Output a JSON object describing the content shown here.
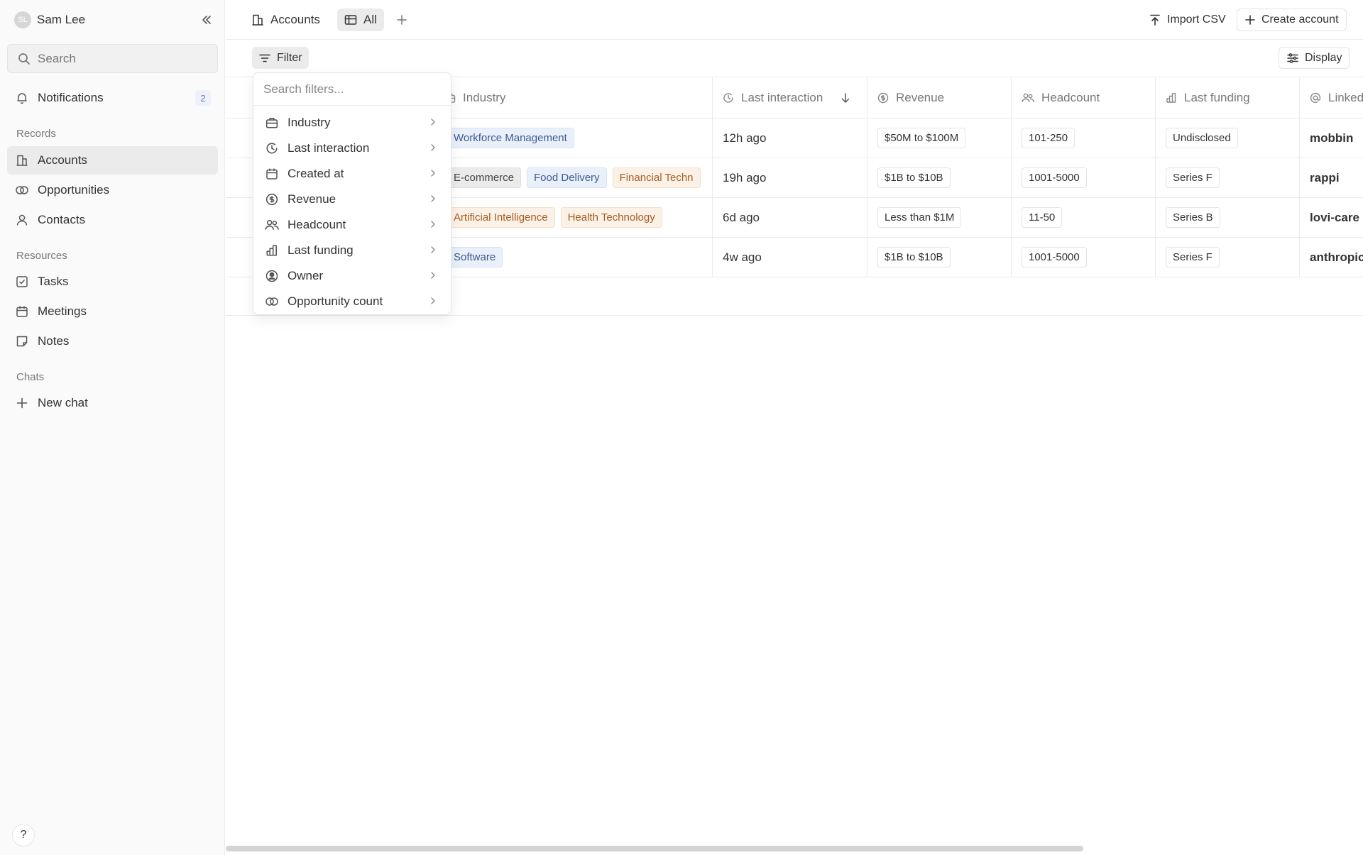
{
  "user": {
    "initials": "SL",
    "name": "Sam Lee"
  },
  "sidebar": {
    "search_placeholder": "Search",
    "notifications": {
      "label": "Notifications",
      "count": "2"
    },
    "sections": {
      "records": "Records",
      "resources": "Resources",
      "chats": "Chats"
    },
    "records": [
      {
        "label": "Accounts",
        "icon": "building-icon",
        "active": true
      },
      {
        "label": "Opportunities",
        "icon": "opportunities-icon",
        "active": false
      },
      {
        "label": "Contacts",
        "icon": "person-icon",
        "active": false
      }
    ],
    "resources": [
      {
        "label": "Tasks",
        "icon": "checkbox-icon"
      },
      {
        "label": "Meetings",
        "icon": "calendar-icon"
      },
      {
        "label": "Notes",
        "icon": "note-icon"
      }
    ],
    "new_chat": "New chat",
    "help": "?"
  },
  "topbar": {
    "object_label": "Accounts",
    "view_label": "All",
    "import_label": "Import CSV",
    "create_label": "Create account"
  },
  "toolbar": {
    "filter_label": "Filter",
    "display_label": "Display"
  },
  "table": {
    "headers": {
      "industry": "Industry",
      "last_interaction": "Last interaction",
      "revenue": "Revenue",
      "headcount": "Headcount",
      "last_funding": "Last funding",
      "linkedin": "Linked"
    },
    "rows": [
      {
        "industries": [
          {
            "label": "Workforce Management",
            "color": "blue"
          }
        ],
        "last_interaction": "12h ago",
        "revenue": "$50M to $100M",
        "headcount": "101-250",
        "last_funding": "Undisclosed",
        "linkedin": "mobbin"
      },
      {
        "industries": [
          {
            "label": "E-commerce",
            "color": "gray"
          },
          {
            "label": "Food Delivery",
            "color": "blue"
          },
          {
            "label": "Financial Techn",
            "color": "orange"
          }
        ],
        "last_interaction": "19h ago",
        "revenue": "$1B to $10B",
        "headcount": "1001-5000",
        "last_funding": "Series F",
        "linkedin": "rappi"
      },
      {
        "industries": [
          {
            "label": "Artificial Intelligence",
            "color": "orange"
          },
          {
            "label": "Health Technology",
            "color": "orange"
          }
        ],
        "last_interaction": "6d ago",
        "revenue": "Less than $1M",
        "headcount": "11-50",
        "last_funding": "Series B",
        "linkedin": "lovi-care"
      },
      {
        "industries": [
          {
            "label": "Software",
            "color": "blue"
          }
        ],
        "last_interaction": "4w ago",
        "revenue": "$1B to $10B",
        "headcount": "1001-5000",
        "last_funding": "Series F",
        "linkedin": "anthropic"
      }
    ]
  },
  "filter_menu": {
    "search_placeholder": "Search filters...",
    "items": [
      {
        "label": "Industry",
        "icon": "briefcase-icon"
      },
      {
        "label": "Last interaction",
        "icon": "interaction-icon"
      },
      {
        "label": "Created at",
        "icon": "calendar-icon"
      },
      {
        "label": "Revenue",
        "icon": "dollar-icon"
      },
      {
        "label": "Headcount",
        "icon": "people-icon"
      },
      {
        "label": "Last funding",
        "icon": "bar-chart-icon"
      },
      {
        "label": "Owner",
        "icon": "user-circle-icon"
      },
      {
        "label": "Opportunity count",
        "icon": "opportunities-icon"
      }
    ]
  },
  "colors": {
    "tag_blue_bg": "#eaf0fa",
    "tag_orange_bg": "#fcf1e6",
    "tag_gray_bg": "#ebebeb",
    "badge_text": "#6b7db4"
  }
}
